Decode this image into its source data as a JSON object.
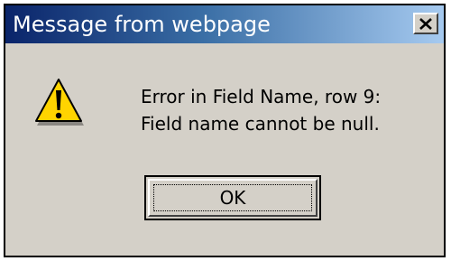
{
  "dialog": {
    "title": "Message from webpage",
    "close_icon": "close-icon",
    "icon": "warning-icon",
    "message_lines": [
      "Error in Field Name, row 9:",
      "Field name cannot be null."
    ],
    "ok_label": "OK"
  },
  "colors": {
    "titlebar_start": "#0a246a",
    "titlebar_end": "#a6caf0",
    "dialog_face": "#d4d0c8",
    "warning_yellow": "#ffd400"
  }
}
